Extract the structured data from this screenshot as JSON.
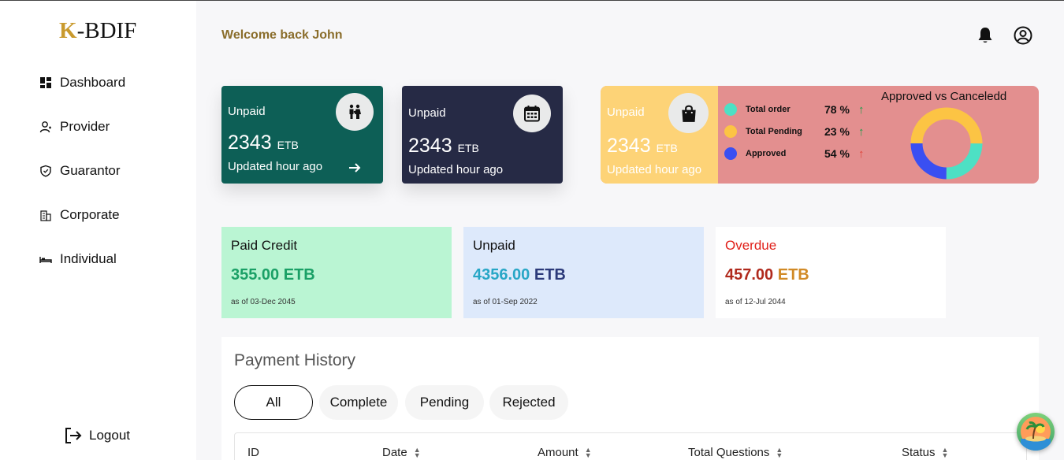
{
  "brand": {
    "logo_k": "K",
    "logo_rest": "-BDIF"
  },
  "sidebar": {
    "items": [
      {
        "label": "Dashboard",
        "icon": "dashboard-icon"
      },
      {
        "label": "Provider",
        "icon": "user-icon"
      },
      {
        "label": "Guarantor",
        "icon": "shield-icon"
      },
      {
        "label": "Corporate",
        "icon": "building-icon"
      },
      {
        "label": "Individual",
        "icon": "bed-icon"
      }
    ],
    "logout_label": "Logout"
  },
  "header": {
    "welcome": "Welcome back John",
    "icons": [
      "bell-icon",
      "account-icon"
    ]
  },
  "stats": [
    {
      "title": "Unpaid",
      "value": "2343",
      "unit": "ETB",
      "updated": "Updated hour ago",
      "icon": "family-icon",
      "color": "#0d5f56"
    },
    {
      "title": "Unpaid",
      "value": "2343",
      "unit": "ETB",
      "updated": "Updated hour ago",
      "icon": "calendar-icon",
      "color": "#262a45"
    },
    {
      "title": "Unpaid",
      "value": "2343",
      "unit": "ETB",
      "updated": "Updated hour ago",
      "icon": "shopping-bag-icon",
      "color": "#fdd377"
    }
  ],
  "summary": {
    "legend": [
      {
        "label": "Total order",
        "pct": "78 %",
        "color": "#4de0c4",
        "trend": "up",
        "trend_color": "#1a9e4a"
      },
      {
        "label": "Total Pending",
        "pct": "23 %",
        "color": "#fcc444",
        "trend": "up",
        "trend_color": "#1a9e4a"
      },
      {
        "label": "Approved",
        "pct": "54 %",
        "color": "#3a4ff2",
        "trend": "up",
        "trend_color": "#e0453a"
      }
    ],
    "donut_title": "Approved vs Canceledd",
    "donut_segments": [
      {
        "color": "#fcc444",
        "fraction": 0.5
      },
      {
        "color": "#4de0c4",
        "fraction": 0.25
      },
      {
        "color": "#3a4ff2",
        "fraction": 0.25
      }
    ]
  },
  "cards": [
    {
      "title": "Paid Credit",
      "amount": "355.00",
      "unit": "ETB",
      "date": "as of 03-Dec 2045",
      "bg": "#baf5d3",
      "title_color": "#111111",
      "amount_color": "#1aa066",
      "unit_color": "#1aa066"
    },
    {
      "title": "Unpaid",
      "amount": "4356.00",
      "unit": "ETB",
      "date": "as of 01-Sep 2022",
      "bg": "#dde9fb",
      "title_color": "#111111",
      "amount_color": "#27a6c6",
      "unit_color": "#2c3a7a"
    },
    {
      "title": "Overdue",
      "amount": "457.00",
      "unit": "ETB",
      "date": "as of 12-Jul 2044",
      "bg": "#ffffff",
      "title_color": "#e0201a",
      "amount_color": "#b02a1d",
      "unit_color": "#d18a26"
    }
  ],
  "history": {
    "title": "Payment History",
    "tabs": [
      "All",
      "Complete",
      "Pending",
      "Rejected"
    ],
    "active_tab": "All",
    "columns": [
      "ID",
      "Date",
      "Amount",
      "Total Questions",
      "Status"
    ]
  },
  "fab_icon": "island-icon"
}
